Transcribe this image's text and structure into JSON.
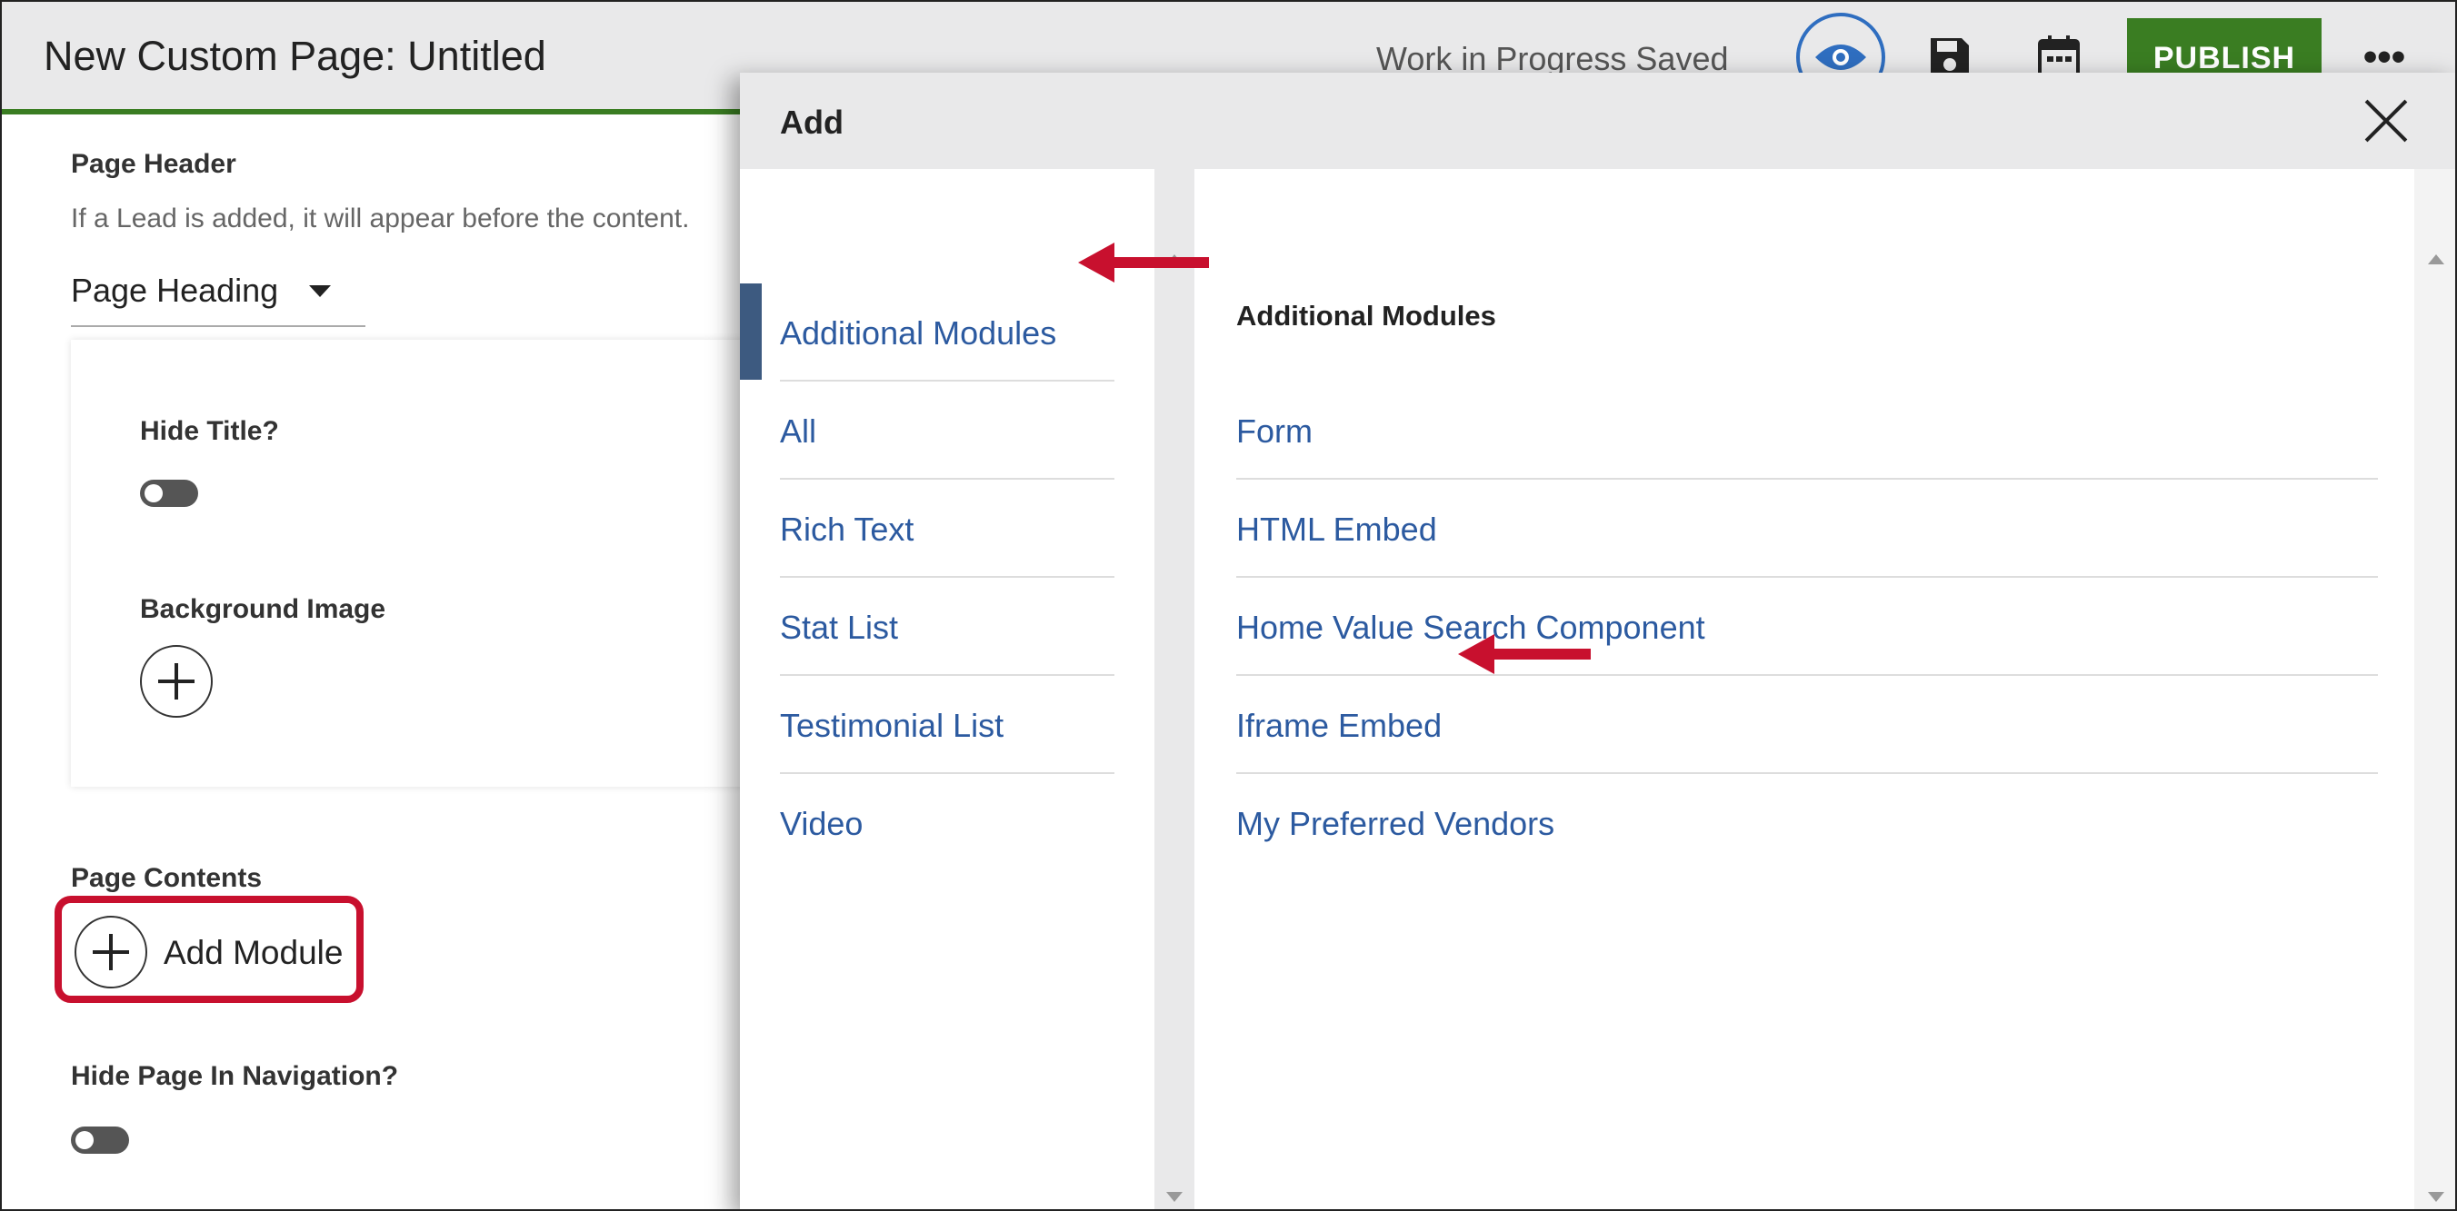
{
  "header": {
    "title": "New Custom Page: Untitled",
    "status": "Work in Progress Saved",
    "publish_label": "PUBLISH",
    "icons": [
      "eye-icon",
      "save-icon",
      "calendar-icon",
      "more-icon"
    ]
  },
  "page_header": {
    "label": "Page Header",
    "help": "If a Lead is added, it will appear before the content.",
    "select_value": "Page Heading",
    "hide_title_label": "Hide Title?",
    "background_image_label": "Background Image"
  },
  "page_contents": {
    "label": "Page Contents",
    "add_module_label": "Add Module"
  },
  "hide_nav_label": "Hide Page In Navigation?",
  "dialog": {
    "title": "Add",
    "categories": [
      "Additional Modules",
      "All",
      "Rich Text",
      "Stat List",
      "Testimonial List",
      "Video"
    ],
    "active_category": "Additional Modules",
    "modules_heading": "Additional Modules",
    "modules": [
      "Form",
      "HTML Embed",
      "Home Value Search Component",
      "Iframe Embed",
      "My Preferred Vendors"
    ]
  },
  "colors": {
    "accent_green": "#3a7d22",
    "link_blue": "#2c5aa0",
    "highlight_red": "#c8102e",
    "active_bar": "#3d5a80"
  }
}
